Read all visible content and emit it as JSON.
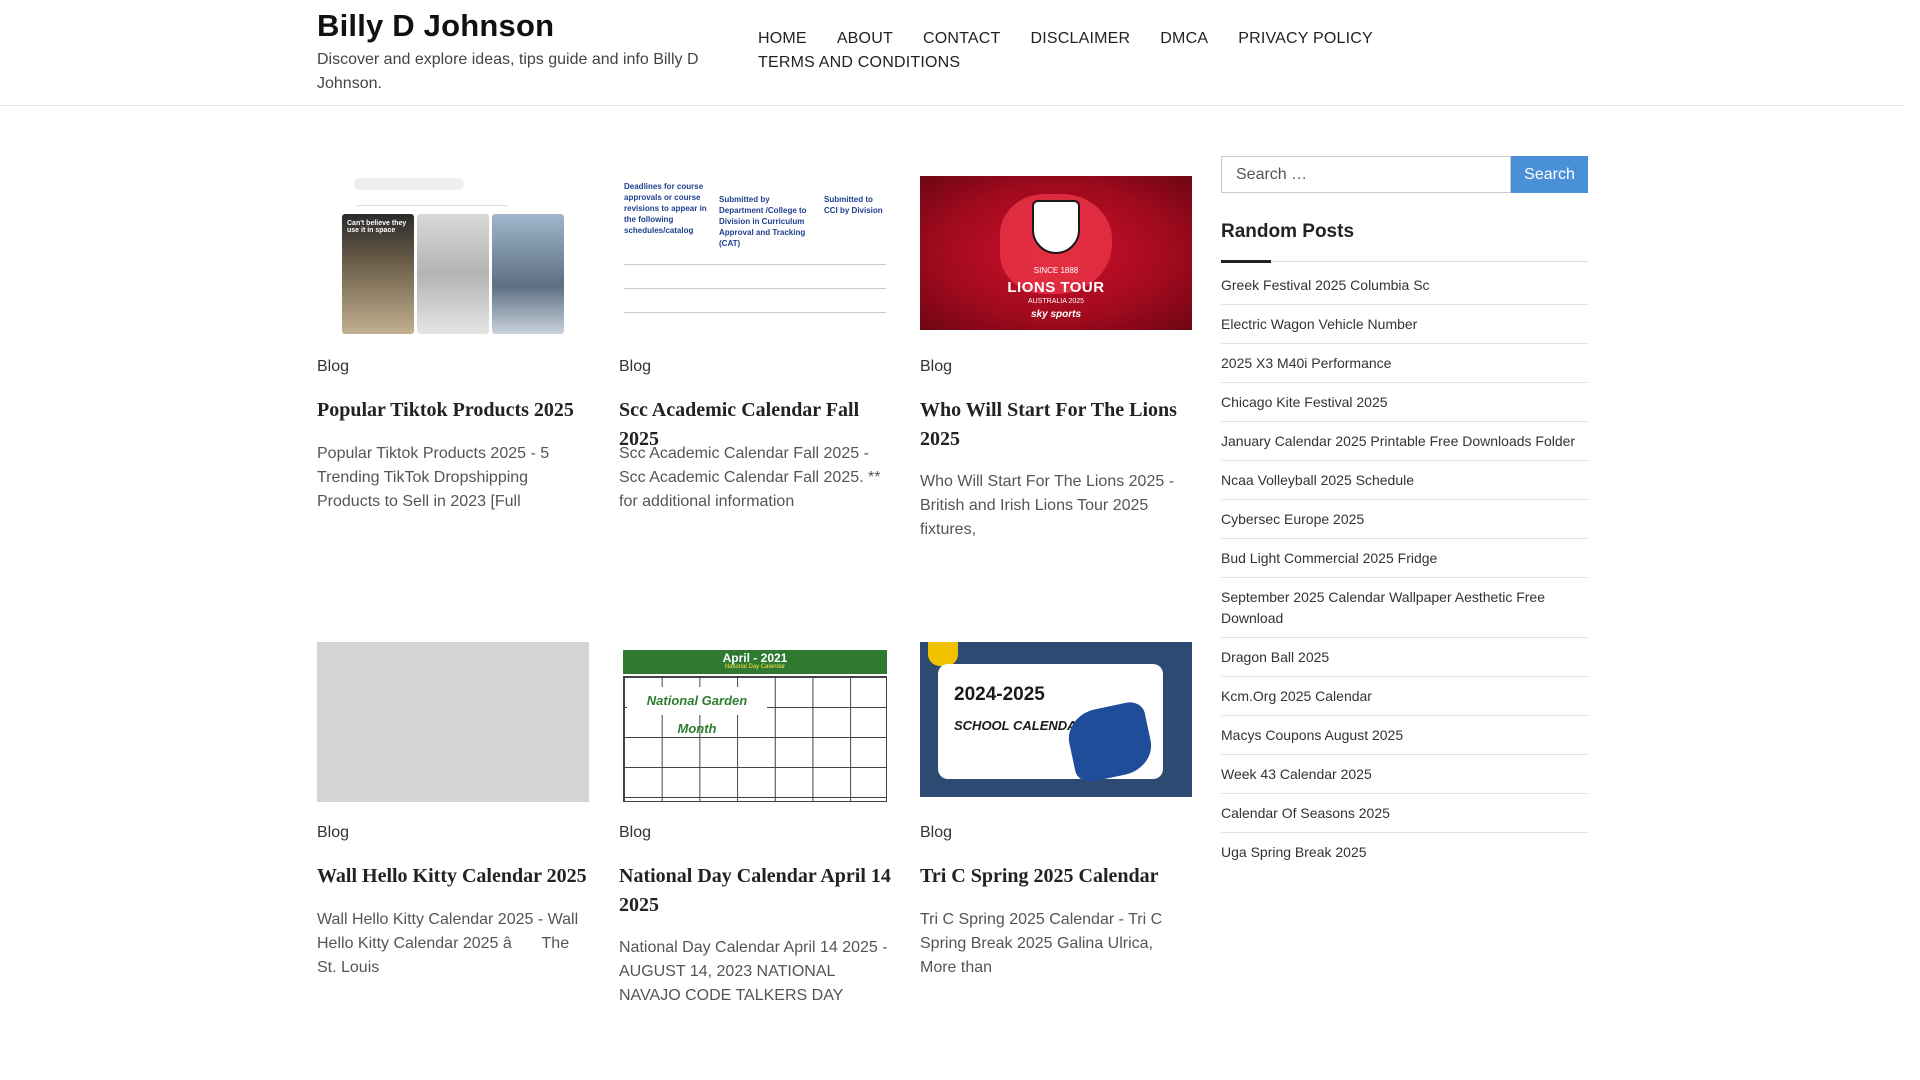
{
  "header": {
    "site_title": "Billy D Johnson",
    "site_description": "Discover and explore ideas, tips guide and info Billy D Johnson."
  },
  "nav": {
    "items": [
      {
        "label": "HOME"
      },
      {
        "label": "ABOUT"
      },
      {
        "label": "CONTACT"
      },
      {
        "label": "DISCLAIMER"
      },
      {
        "label": "DMCA"
      },
      {
        "label": "PRIVACY POLICY"
      },
      {
        "label": "TERMS AND CONDITIONS"
      }
    ]
  },
  "posts": [
    {
      "category": "Blog",
      "title": "Popular Tiktok Products 2025",
      "excerpt": "Popular Tiktok Products 2025 - 5 Trending TikTok Dropshipping Products to Sell in 2023 [Full",
      "thumb_caption": "Can't believe they use it in space"
    },
    {
      "category": "Blog",
      "title": "Scc Academic Calendar Fall 2025",
      "excerpt": "Scc Academic Calendar Fall 2025 - Scc Academic Calendar Fall 2025. ** for additional information",
      "thumb_heading_1": "Deadlines for course approvals or course revisions to appear in the following schedules/catalog",
      "thumb_heading_2": "Submitted by Department /College to Division in Curriculum Approval and Tracking (CAT)",
      "thumb_heading_3": "Submitted to CCI by Division"
    },
    {
      "category": "Blog",
      "title": "Who Will Start For The Lions 2025",
      "excerpt": "Who Will Start For The Lions 2025 - British and Irish Lions Tour 2025 fixtures,",
      "thumb_since": "SINCE 1888",
      "thumb_tour": "LIONS TOUR",
      "thumb_sub": "AUSTRALIA 2025",
      "thumb_brand": "sky sports"
    },
    {
      "category": "Blog",
      "title": "Wall Hello Kitty Calendar 2025",
      "excerpt": "Wall Hello Kitty Calendar 2025 - Wall Hello Kitty Calendar 2025 â The St. Louis"
    },
    {
      "category": "Blog",
      "title": "National Day Calendar April 14 2025",
      "excerpt": "National Day Calendar April 14 2025 - AUGUST 14, 2023 NATIONAL NAVAJO CODE TALKERS DAY",
      "thumb_title": "April - 2021",
      "thumb_sub": "National Day Calendar",
      "thumb_month": "National Garden Month"
    },
    {
      "category": "Blog",
      "title": "Tri C Spring 2025 Calendar",
      "excerpt": "Tri C Spring 2025 Calendar - Tri C Spring Break 2025 Galina Ulrica, More than",
      "thumb_year": "2024-2025",
      "thumb_label": "SCHOOL CALENDAR"
    }
  ],
  "sidebar": {
    "search": {
      "placeholder": "Search …",
      "button_label": "Search"
    },
    "random_posts": {
      "title": "Random Posts",
      "items": [
        "Greek Festival 2025 Columbia Sc",
        "Electric Wagon Vehicle Number",
        "2025 X3 M40i Performance",
        "Chicago Kite Festival 2025",
        "January Calendar 2025 Printable Free Downloads Folder",
        "Ncaa Volleyball 2025 Schedule",
        "Cybersec Europe 2025",
        "Bud Light Commercial 2025 Fridge",
        "September 2025 Calendar Wallpaper Aesthetic Free Download",
        "Dragon Ball 2025",
        "Kcm.Org 2025 Calendar",
        "Macys Coupons August 2025",
        "Week 43 Calendar 2025",
        "Calendar Of Seasons 2025",
        "Uga Spring Break 2025"
      ]
    }
  },
  "colors": {
    "accent": "#4a90d9",
    "text": "#333333"
  }
}
